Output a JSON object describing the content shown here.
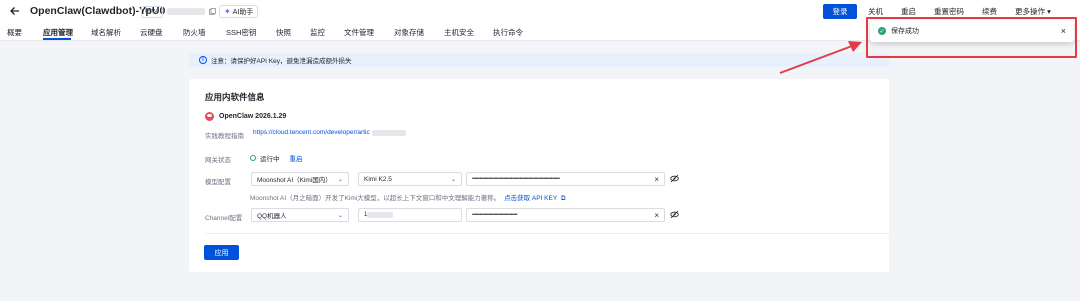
{
  "header": {
    "title": "OpenClaw(Clawdbot)-YpU0",
    "ip_label": "IPv4",
    "ai_label": "AI助手",
    "login_label": "登录",
    "actions": [
      "关机",
      "重启",
      "重置密码",
      "续费",
      "更多操作 ▾"
    ]
  },
  "tabs": [
    "概要",
    "应用管理",
    "域名解析",
    "云硬盘",
    "防火墙",
    "SSH密钥",
    "快照",
    "监控",
    "文件管理",
    "对象存储",
    "主机安全",
    "执行命令"
  ],
  "notice": {
    "text": "注意：请保护好API Key，避免泄漏造成额外损失"
  },
  "card": {
    "section_title": "应用内软件信息",
    "app_name": "OpenClaw 2026.1.29",
    "tutorial_label": "实践教程指南",
    "tutorial_link": "https://cloud.tencent.com/developer/artic",
    "gateway_label": "网关状态",
    "gateway_status": "运行中",
    "restart_label": "重启",
    "model_label": "模型配置",
    "model_provider": "Moonshot AI（Kimi国内）",
    "model_name": "Kimi K2.5",
    "model_key": "••••••••••••••••••••••••••••••••••••••••••••••••••••••••••••••••••••••",
    "hint_text": "Moonshot AI（月之暗面）开发了Kimi大模型，以超长上下文窗口和中文理解能力著称。",
    "hint_link": "点击获取 API KEY",
    "channel_label": "Channel配置",
    "channel_type": "QQ机器人",
    "channel_id_prefix": "1",
    "channel_key": "••••••••••••••••••••••••••••••••••••",
    "apply_label": "应用"
  },
  "toast": {
    "text": "保存成功"
  },
  "colors": {
    "primary": "#0052d9",
    "success": "#2ba471",
    "annotation": "#e63946"
  }
}
